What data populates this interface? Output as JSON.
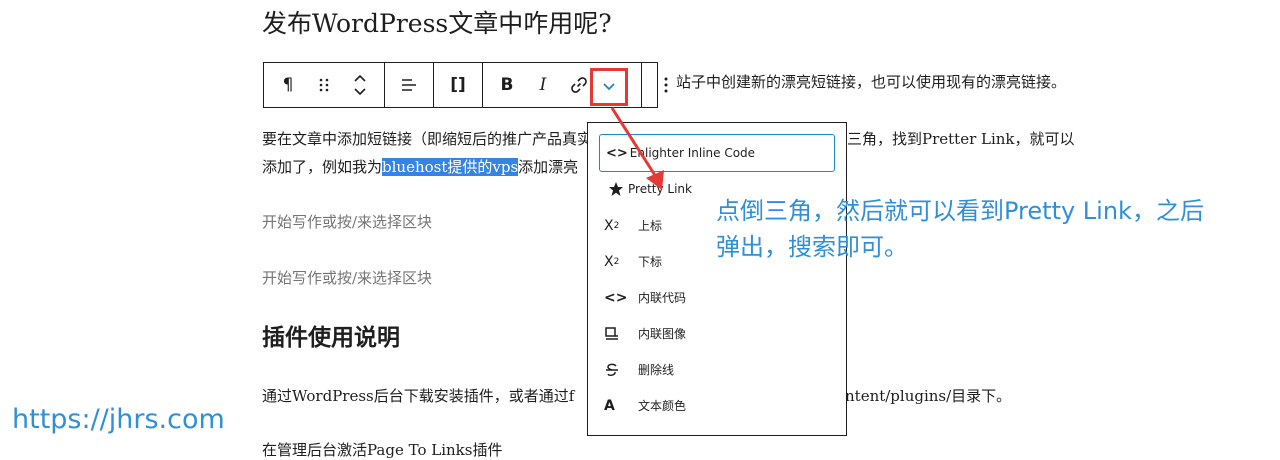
{
  "post": {
    "title_line": "发布WordPress文章中咋用呢?",
    "para1_tail": "站子中创建新的漂亮短链接，也可以使用现有的漂亮链接。",
    "para2_line1_start": "要在文章中添加短链接（即缩短后的推广产品真实",
    "para2_line1_end": "倒三角，找到Pretter Link，就可以",
    "para2_line2_start": "添加了，例如我为",
    "para2_selected": "bluehost提供的vps",
    "para2_line2_end": "添加漂亮",
    "placeholder_1": "开始写作或按/来选择区块",
    "placeholder_2": "开始写作或按/来选择区块",
    "section_heading": "插件使用说明",
    "para3_start": "通过WordPress后台下载安装插件，或者通过f",
    "para3_end": "ntent/plugins/目录下。",
    "para4": "在管理后台激活Page To Links插件"
  },
  "toolbar": {
    "paragraph_icon": "pilcrow-icon",
    "drag_icon": "drag-handle-icon",
    "move_icon": "move-up-down-icon",
    "align_icon": "align-left-icon",
    "bracket_label": "[]",
    "bold_label": "B",
    "italic_label": "I",
    "link_icon": "link-icon",
    "more_rich_icon": "chevron-down-icon",
    "options_icon": "more-vertical-icon"
  },
  "dropdown": {
    "search_value": "Enlighter Inline Code",
    "items": [
      {
        "label": "Pretty Link",
        "icon": "star-icon"
      },
      {
        "label": "上标",
        "icon": "superscript-icon"
      },
      {
        "label": "下标",
        "icon": "subscript-icon"
      },
      {
        "label": "内联代码",
        "icon": "code-icon"
      },
      {
        "label": "内联图像",
        "icon": "inline-image-icon"
      },
      {
        "label": "删除线",
        "icon": "strikethrough-icon"
      },
      {
        "label": "文本颜色",
        "icon": "text-color-icon"
      }
    ]
  },
  "annotation": {
    "line1": "点倒三角，然后就可以看到Pretty Link，之后",
    "line2": "弹出，搜索即可。"
  },
  "watermark": "https://jhrs.com",
  "colors": {
    "accent_red": "#e53935",
    "annotation_blue": "#2f8fd8",
    "selection_blue": "#3584e4"
  }
}
